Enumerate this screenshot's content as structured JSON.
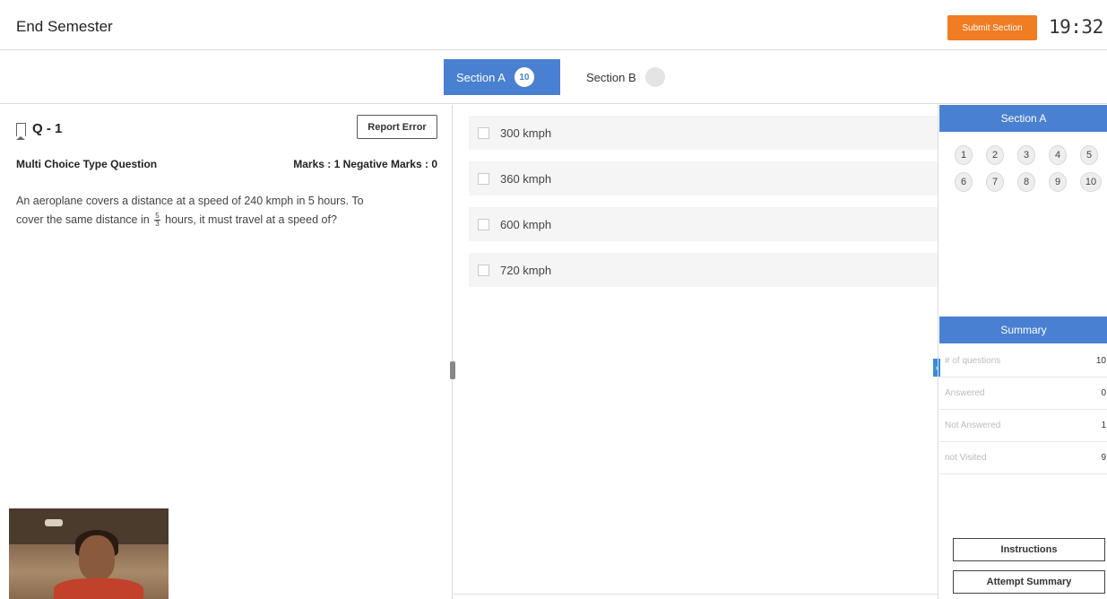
{
  "header": {
    "title": "End Semester",
    "submit_label": "Submit Section",
    "timer": "19:32",
    "submit_color": "#f07c24"
  },
  "tabs": [
    {
      "label": "Section A",
      "count": "10",
      "active": true
    },
    {
      "label": "Section B",
      "count": "0",
      "active": false
    }
  ],
  "question": {
    "number": "Q - 1",
    "report_label": "Report Error",
    "type": "Multi Choice Type Question",
    "marks": "Marks : 1  Negative Marks : 0",
    "text_line1": "An aeroplane covers a distance at a speed of 240 kmph in 5 hours. To",
    "text_line2a": "cover the same distance in",
    "frac_num": "5",
    "frac_den": "3",
    "text_line2b": "hours, it must travel at a speed of?"
  },
  "options": [
    "300 kmph",
    "360 kmph",
    "600 kmph",
    "720 kmph"
  ],
  "palette": {
    "title": "Section A",
    "questions": [
      "1",
      "2",
      "3",
      "4",
      "5",
      "6",
      "7",
      "8",
      "9",
      "10"
    ],
    "accent": "#4a80d1"
  },
  "summary": {
    "title": "Summary",
    "rows": [
      {
        "label": "# of questions",
        "value": "10"
      },
      {
        "label": "Answered",
        "value": "0"
      },
      {
        "label": "Not Answered",
        "value": "1"
      },
      {
        "label": "not Visited",
        "value": "9"
      }
    ]
  },
  "buttons": {
    "instructions": "Instructions",
    "attempt_summary": "Attempt Summary"
  },
  "icons": {
    "bookmark": "bookmark-icon",
    "collapse": "chevron-right-icon",
    "drag": "drag-handle-icon"
  }
}
